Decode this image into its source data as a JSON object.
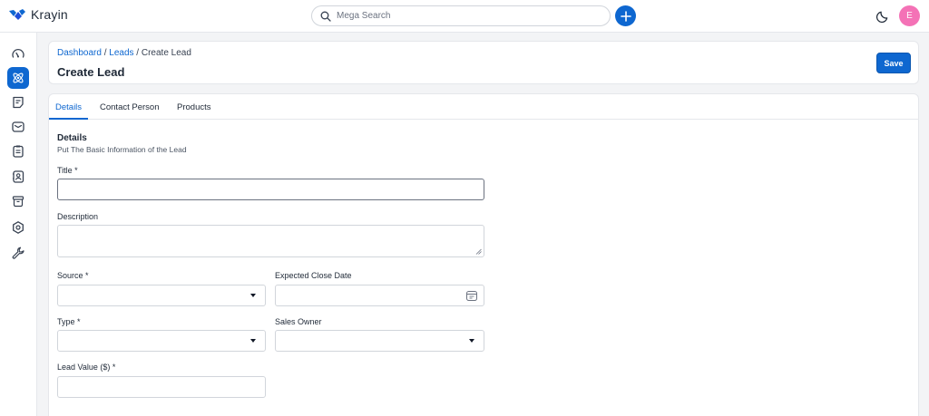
{
  "app": {
    "name": "Krayin"
  },
  "search": {
    "placeholder": "Mega Search"
  },
  "avatar": {
    "initial": "E",
    "color": "#f472b6"
  },
  "sidebar": {
    "items": [
      {
        "name": "dashboard",
        "icon": "speedometer-icon",
        "active": false
      },
      {
        "name": "leads",
        "icon": "atom-icon",
        "active": true
      },
      {
        "name": "quotes",
        "icon": "note-icon",
        "active": false
      },
      {
        "name": "mail",
        "icon": "mail-icon",
        "active": false
      },
      {
        "name": "activities",
        "icon": "clipboard-icon",
        "active": false
      },
      {
        "name": "contacts",
        "icon": "contact-icon",
        "active": false
      },
      {
        "name": "products",
        "icon": "box-icon",
        "active": false
      },
      {
        "name": "settings",
        "icon": "gear-icon",
        "active": false
      },
      {
        "name": "configuration",
        "icon": "wrench-icon",
        "active": false
      }
    ]
  },
  "breadcrumb": {
    "dashboard": "Dashboard",
    "leads": "Leads",
    "current": "Create Lead",
    "separator": "/"
  },
  "page": {
    "title": "Create Lead",
    "save_label": "Save"
  },
  "tabs": [
    "Details",
    "Contact Person",
    "Products"
  ],
  "details": {
    "title": "Details",
    "subtitle": "Put The Basic Information of the Lead"
  },
  "fields": {
    "title": {
      "label": "Title *",
      "value": ""
    },
    "description": {
      "label": "Description",
      "value": ""
    },
    "source": {
      "label": "Source *",
      "value": ""
    },
    "expected_close_date": {
      "label": "Expected Close Date",
      "value": ""
    },
    "type": {
      "label": "Type *",
      "value": ""
    },
    "sales_owner": {
      "label": "Sales Owner",
      "value": ""
    },
    "lead_value": {
      "label": "Lead Value ($) *",
      "value": ""
    }
  },
  "colors": {
    "accent": "#0e67d0",
    "border": "#d1d5db",
    "background": "#f3f4f6"
  }
}
